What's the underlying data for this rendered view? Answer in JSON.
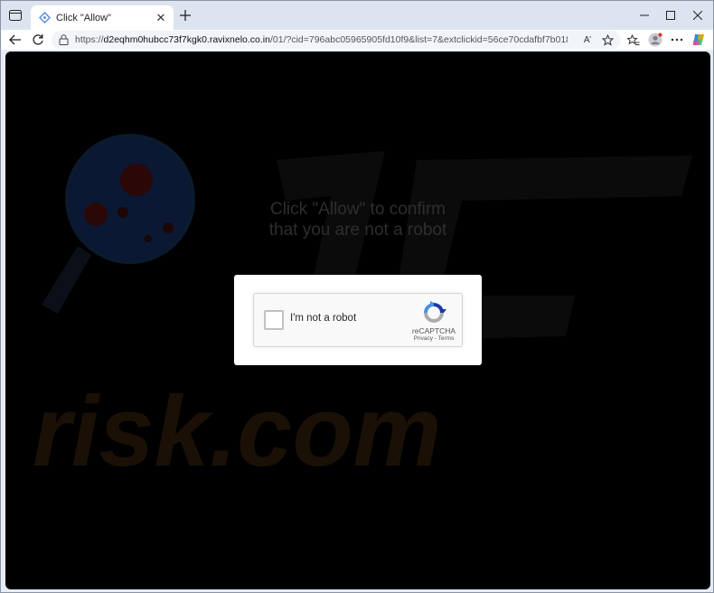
{
  "browser": {
    "tab": {
      "title": "Click \"Allow\"",
      "close_glyph": "✕"
    },
    "new_tab_icon": "plus-icon",
    "window_controls": [
      "minimize-icon",
      "maximize-icon",
      "close-icon"
    ],
    "address": {
      "scheme": "https://",
      "host": "d2eqhm0hubcc73f7kgk0.ravixnelo.co.in",
      "path": "/01/?cid=796abc05965905fd10f9&list=7&extclickid=56ce70cdafbf7b01832bbd329e29...",
      "read_aloud_label": "A’"
    }
  },
  "page": {
    "headline_line1": "Click \"Allow\" to confirm",
    "headline_line2": "that you are not a robot",
    "captcha": {
      "label": "I'm not a robot",
      "brand": "reCAPTCHA",
      "links": "Privacy - Terms",
      "checked": false
    }
  },
  "colors": {
    "page_bg": "#000000",
    "headline": "#2e2e2e",
    "recaptcha_blue": "#1c3aa9",
    "recaptcha_light_blue": "#4a90e2",
    "recaptcha_grey": "#ababab"
  }
}
